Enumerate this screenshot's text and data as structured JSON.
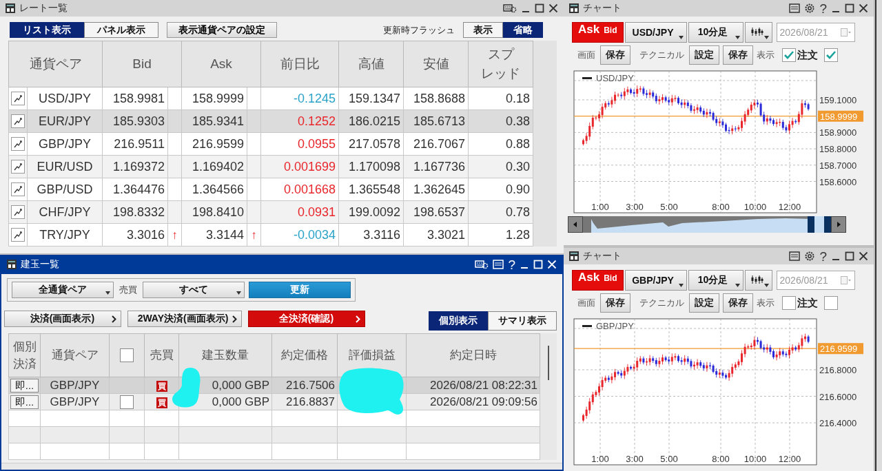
{
  "rate_window": {
    "title": "レート一覧",
    "view_tabs": [
      {
        "label": "リスト表示",
        "selected": true
      },
      {
        "label": "パネル表示",
        "selected": false
      }
    ],
    "pair_settings_button": "表示通貨ペアの設定",
    "flash_label": "更新時フラッシュ",
    "flash_options": [
      {
        "label": "表示",
        "selected": false
      },
      {
        "label": "省略",
        "selected": true
      }
    ],
    "columns": [
      "通貨ペア",
      "Bid",
      "Ask",
      "前日比",
      "高値",
      "安値",
      [
        "スプ",
        "レッド"
      ]
    ],
    "rows": [
      {
        "pair": "USD/JPY",
        "bid": "158.9981",
        "ask": "158.9999",
        "change": "-0.1245",
        "color": "#2ba3c9",
        "high": "159.1347",
        "low": "158.8688",
        "spread": "0.18",
        "selected": false
      },
      {
        "pair": "EUR/JPY",
        "bid": "185.9303",
        "ask": "185.9341",
        "change": "0.1252",
        "color": "#e8262b",
        "high": "186.0215",
        "low": "185.6713",
        "spread": "0.38",
        "selected": true
      },
      {
        "pair": "GBP/JPY",
        "bid": "216.9511",
        "ask": "216.9599",
        "change": "0.0955",
        "color": "#e8262b",
        "high": "217.0578",
        "low": "216.7067",
        "spread": "0.88",
        "selected": false
      },
      {
        "pair": "EUR/USD",
        "bid": "1.169372",
        "ask": "1.169402",
        "change": "0.001699",
        "color": "#e8262b",
        "high": "1.170098",
        "low": "1.167736",
        "spread": "0.30",
        "selected": false
      },
      {
        "pair": "GBP/USD",
        "bid": "1.364476",
        "ask": "1.364566",
        "change": "0.001668",
        "color": "#e8262b",
        "high": "1.365548",
        "low": "1.362645",
        "spread": "0.90",
        "selected": false
      },
      {
        "pair": "CHF/JPY",
        "bid": "198.8332",
        "ask": "198.8410",
        "change": "0.0931",
        "color": "#e8262b",
        "high": "199.0092",
        "low": "198.6537",
        "spread": "0.78",
        "selected": false
      },
      {
        "pair": "TRY/JPY",
        "bid": "3.3016",
        "bid_flash": "↑",
        "ask": "3.3144",
        "ask_flash": "↑",
        "change": "-0.0034",
        "color": "#2ba3c9",
        "high": "3.3116",
        "low": "3.3021",
        "spread": "1.28",
        "selected": false
      }
    ]
  },
  "positions_window": {
    "title": "建玉一覧",
    "help_glyph": "?",
    "pair_filter": "全通貨ペア",
    "side_label": "売買",
    "side_filter": "すべて",
    "refresh_button": "更新",
    "actions": [
      {
        "label": "決済(画面表示)",
        "kind": "normal"
      },
      {
        "label": "2WAY決済(画面表示)",
        "kind": "normal"
      },
      {
        "label": "全決済(確認)",
        "kind": "danger"
      }
    ],
    "view_tabs": [
      {
        "label": "個別表示",
        "selected": true
      },
      {
        "label": "サマリ表示",
        "selected": false
      }
    ],
    "columns": [
      {
        "kind": "text",
        "label": [
          "個別",
          "決済"
        ]
      },
      {
        "kind": "text",
        "label": "通貨ペア"
      },
      {
        "kind": "checkbox",
        "checked": false
      },
      {
        "kind": "text",
        "label": "売買"
      },
      {
        "kind": "text",
        "label": "建玉数量"
      },
      {
        "kind": "text",
        "label": "約定価格"
      },
      {
        "kind": "text",
        "label": "評価損益"
      },
      {
        "kind": "text",
        "label": "約定日時"
      }
    ],
    "rows": [
      {
        "settle_button": "即...",
        "pair": "GBP/JPY",
        "kind": "locked",
        "side": "買",
        "quantity": "0,000 GBP",
        "price": "216.7506",
        "time": "2026/08/21 08:22:31",
        "selected": true
      },
      {
        "settle_button": "即...",
        "pair": "GBP/JPY",
        "kind": "selectable",
        "checked": false,
        "side": "買",
        "quantity": "0,000 GBP",
        "price": "216.8837",
        "time": "2026/08/21 09:09:56",
        "selected": false
      }
    ]
  },
  "charts": [
    {
      "title": "チャート",
      "help_glyph": "?",
      "price_sides": [
        {
          "label": "Ask",
          "selected": true
        },
        {
          "label": "Bid",
          "selected": false
        }
      ],
      "pair": "USD/JPY",
      "timeframe": "10分足",
      "date": "2026/08/21",
      "screen_label": "画面",
      "screen_save": "保存",
      "technical_label": "テクニカル",
      "technical_settings": "設定",
      "technical_save": "保存",
      "display_label": "表示",
      "display_options": [
        {
          "label": "注文",
          "checked": true
        },
        {
          "checked": true
        }
      ],
      "legend": "USD/JPY",
      "y_ticks": [
        "159.1000",
        "158.9000",
        "158.8000",
        "158.7000",
        "158.6000"
      ],
      "current_price": "158.9999",
      "x_ticks": [
        "1:00",
        "3:00",
        "5:00",
        "8:00",
        "10:00",
        "12:00"
      ],
      "navigator": true
    },
    {
      "title": "チャート",
      "help_glyph": "?",
      "price_sides": [
        {
          "label": "Ask",
          "selected": true
        },
        {
          "label": "Bid",
          "selected": false
        }
      ],
      "pair": "GBP/JPY",
      "timeframe": "10分足",
      "date": "2026/08/21",
      "screen_label": "画面",
      "screen_save": "保存",
      "technical_label": "テクニカル",
      "technical_settings": "設定",
      "technical_save": "保存",
      "display_label": "表示",
      "display_options": [
        {
          "label": "注文",
          "checked": false
        },
        {
          "checked": false
        }
      ],
      "legend": "GBP/JPY",
      "y_ticks": [
        "216.8000",
        "216.6000",
        "216.4000"
      ],
      "current_price": "216.9599",
      "x_ticks": [
        "1:00",
        "3:00",
        "5:00",
        "8:00",
        "10:00",
        "12:00"
      ],
      "navigator": false
    }
  ]
}
